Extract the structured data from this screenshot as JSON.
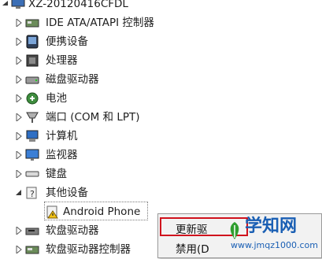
{
  "tree": {
    "root": "XZ-20120416CFDL",
    "items": [
      {
        "label": "IDE ATA/ATAPI 控制器",
        "icon": "ide-controller-icon"
      },
      {
        "label": "便携设备",
        "icon": "portable-device-icon"
      },
      {
        "label": "处理器",
        "icon": "processor-icon"
      },
      {
        "label": "磁盘驱动器",
        "icon": "disk-drive-icon"
      },
      {
        "label": "电池",
        "icon": "battery-icon"
      },
      {
        "label": "端口 (COM 和 LPT)",
        "icon": "port-icon"
      },
      {
        "label": "计算机",
        "icon": "computer-icon"
      },
      {
        "label": "监视器",
        "icon": "monitor-icon"
      },
      {
        "label": "键盘",
        "icon": "keyboard-icon"
      },
      {
        "label": "其他设备",
        "icon": "other-devices-icon"
      },
      {
        "label": "Android Phone",
        "icon": "warning-device-icon"
      },
      {
        "label": "软盘驱动器",
        "icon": "floppy-drive-icon"
      },
      {
        "label": "软盘驱动器控制器",
        "icon": "floppy-controller-icon"
      }
    ]
  },
  "context_menu": {
    "update_driver": "更新驱",
    "disable": "禁用(D"
  },
  "watermark": {
    "title": "学知网",
    "url": "www.jmqz1000.com"
  },
  "colors": {
    "highlight_border": "#d0121d",
    "watermark_green": "#2f9e2f",
    "watermark_blue": "#1a5fb4"
  }
}
